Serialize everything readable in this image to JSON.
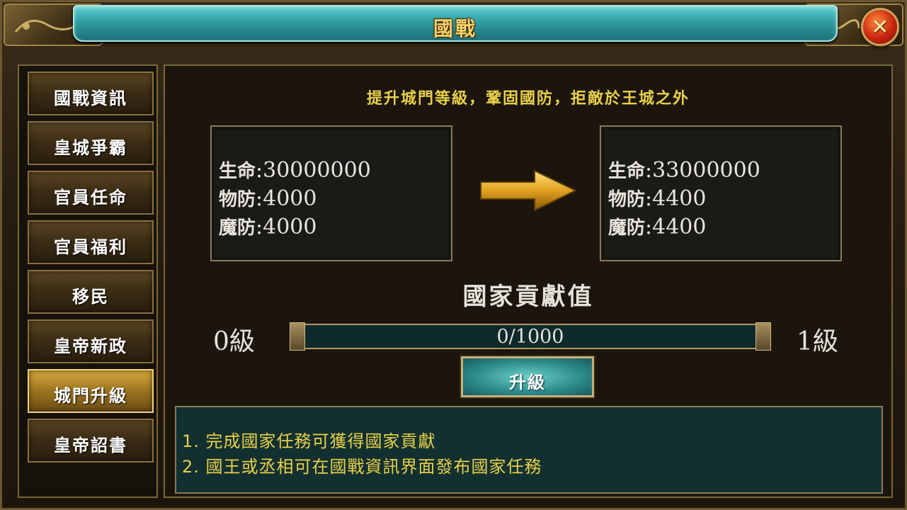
{
  "window": {
    "title": "國戰",
    "close_icon": "close-icon"
  },
  "sidebar": {
    "items": [
      {
        "label": "國戰資訊",
        "active": false
      },
      {
        "label": "皇城爭霸",
        "active": false
      },
      {
        "label": "官員任命",
        "active": false
      },
      {
        "label": "官員福利",
        "active": false
      },
      {
        "label": "移民",
        "active": false
      },
      {
        "label": "皇帝新政",
        "active": false
      },
      {
        "label": "城門升級",
        "active": true
      },
      {
        "label": "皇帝詔書",
        "active": false
      }
    ]
  },
  "main": {
    "headline": "提升城門等級，鞏固國防，拒敵於王城之外",
    "current_stats": [
      {
        "label": "生命",
        "value": "30000000"
      },
      {
        "label": "物防",
        "value": "4000"
      },
      {
        "label": "魔防",
        "value": "4000"
      }
    ],
    "next_stats": [
      {
        "label": "生命",
        "value": "33000000"
      },
      {
        "label": "物防",
        "value": "4400"
      },
      {
        "label": "魔防",
        "value": "4400"
      }
    ],
    "stat_separator": ":",
    "arrow_icon": "right-arrow-icon",
    "contribution_title": "國家貢獻值",
    "level_from": "0級",
    "level_to": "1級",
    "progress_text": "0/1000",
    "progress_fraction": 0,
    "upgrade_button": "升級",
    "notes": [
      "1. 完成國家任務可獲得國家貢獻",
      "2. 國王或丞相可在國戰資訊界面發布國家任務"
    ]
  },
  "colors": {
    "title_teal": "#2f9ea3",
    "gold_text": "#e8d04a",
    "active_tab": "#d6a93c",
    "close_red": "#c9260f"
  }
}
